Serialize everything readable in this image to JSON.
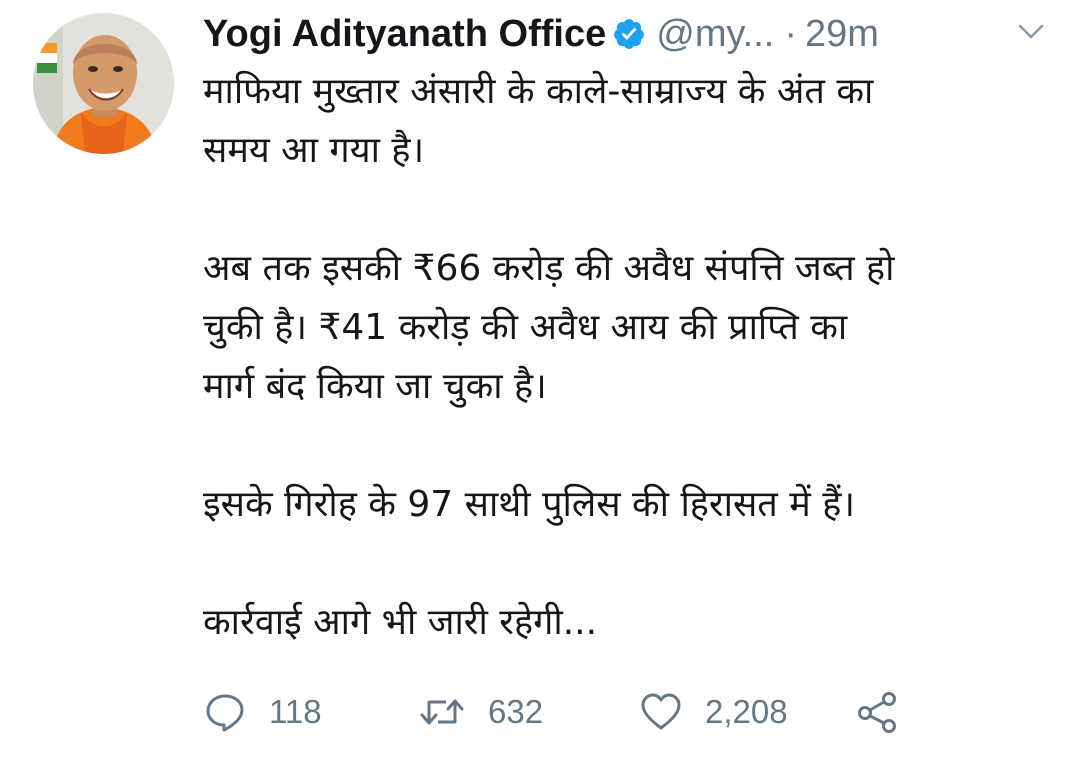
{
  "tweet": {
    "author": {
      "name": "Yogi Adityanath Office",
      "handle": "@my...",
      "verified": true,
      "avatar_icon": "profile-photo"
    },
    "separator": "·",
    "time": "29m",
    "menu_icon": "chevron-down-icon",
    "paragraphs": [
      [
        "माफिया मुख्तार अंसारी के काले-साम्राज्य के अंत का",
        "समय आ गया है।"
      ],
      [
        "अब तक इसकी ₹66 करोड़ की अवैध संपत्ति जब्त हो",
        "चुकी है। ₹41 करोड़ की अवैध आय की प्राप्ति का",
        "मार्ग बंद किया जा चुका है।"
      ],
      [
        "इसके गिरोह के 97 साथी पुलिस की हिरासत में हैं।"
      ],
      [
        "कार्रवाई आगे भी जारी रहेगी..."
      ]
    ],
    "actions": {
      "reply": {
        "icon": "reply-icon",
        "count": "118"
      },
      "retweet": {
        "icon": "retweet-icon",
        "count": "632"
      },
      "like": {
        "icon": "heart-icon",
        "count": "2,208"
      },
      "share": {
        "icon": "share-icon"
      }
    },
    "colors": {
      "text": "#14171a",
      "secondary": "#657786",
      "verified": "#1da1f2"
    }
  }
}
